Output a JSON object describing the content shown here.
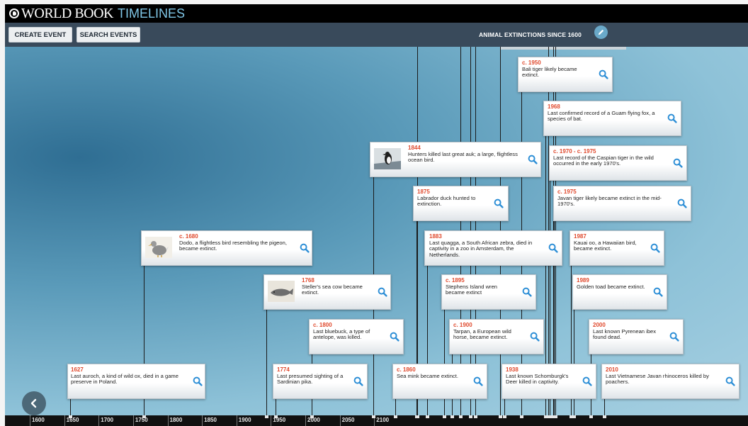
{
  "brand": {
    "name": "WORLD BOOK",
    "product": "TIMELINES"
  },
  "toolbar": {
    "create_label": "CREATE EVENT",
    "search_label": "SEARCH EVENTS",
    "timeline_title": "ANIMAL EXTINCTIONS SINCE 1600"
  },
  "axis": {
    "start": 1600,
    "end": 2100,
    "labels": [
      "1600",
      "1650",
      "1700",
      "1750",
      "1800",
      "1850",
      "1900",
      "1950",
      "2000",
      "2050",
      "2100"
    ]
  },
  "events": [
    {
      "id": "aurochs",
      "year_label": "1627",
      "year": 1627,
      "text": "Last auroch, a kind of wild ox, died in a game preserve in Poland."
    },
    {
      "id": "dodo",
      "year_label": "c. 1680",
      "year": 1680,
      "text": "Dodo, a flightless bird resembling the pigeon, became extinct.",
      "image": "dodo"
    },
    {
      "id": "sea-cow",
      "year_label": "1768",
      "year": 1768,
      "text": "Steller's sea cow became extinct.",
      "image": "sea-cow"
    },
    {
      "id": "pika",
      "year_label": "1774",
      "year": 1774,
      "text": "Last presumed sighting of a Sardinian pika."
    },
    {
      "id": "bluebuck",
      "year_label": "c. 1800",
      "year": 1800,
      "text": "Last bluebuck, a type of antelope, was killed."
    },
    {
      "id": "great-auk",
      "year_label": "1844",
      "year": 1844,
      "text": "Hunters killed last great auk; a large, flightless ocean bird.",
      "image": "great-auk"
    },
    {
      "id": "sea-mink",
      "year_label": "c. 1860",
      "year": 1860,
      "text": "Sea mink became extinct."
    },
    {
      "id": "labrador-duck",
      "year_label": "1875",
      "year": 1875,
      "text": "Labrador duck hunted to extinction."
    },
    {
      "id": "quagga",
      "year_label": "1883",
      "year": 1883,
      "text": "Last quagga, a South African zebra, died in captivity in a zoo in Amsterdam, the Netherlands."
    },
    {
      "id": "wren",
      "year_label": "c. 1895",
      "year": 1895,
      "text": "Stephens Island wren became extinct"
    },
    {
      "id": "tarpan",
      "year_label": "c. 1900",
      "year": 1900,
      "text": "Tarpan, a European wild horse, became extinct."
    },
    {
      "id": "schomburgk",
      "year_label": "1938",
      "year": 1938,
      "text": "Last known Schomburgk's Deer killed in captivity."
    },
    {
      "id": "bali-tiger",
      "year_label": "c. 1950",
      "year": 1950,
      "text": "Bali tiger likely became extinct."
    },
    {
      "id": "flying-fox",
      "year_label": "1968",
      "year": 1968,
      "text": "Last confirmed record of a Guam flying fox, a species of bat."
    },
    {
      "id": "caspian-tiger",
      "year_label": "c. 1970 - c. 1975",
      "year": 1970,
      "text": "Last record of the Caspian tiger in the wild occurred in the early 1970's."
    },
    {
      "id": "javan-tiger",
      "year_label": "c. 1975",
      "year": 1975,
      "text": "Javan tiger likely became extinct in the mid-1970's."
    },
    {
      "id": "kauai-oo",
      "year_label": "1987",
      "year": 1987,
      "text": "Kauai oo, a Hawaiian bird, became extinct."
    },
    {
      "id": "golden-toad",
      "year_label": "1989",
      "year": 1989,
      "text": "Golden toad became extinct."
    },
    {
      "id": "pyrenean-ibex",
      "year_label": "2000",
      "year": 2000,
      "text": "Last known Pyrenean ibex found dead."
    },
    {
      "id": "javan-rhino",
      "year_label": "2010",
      "year": 2010,
      "text": "Last Vietnamese Javan rhinoceros killed by poachers."
    }
  ],
  "icons": {
    "brand": "globe-icon",
    "edit": "pencil-icon",
    "back": "chevron-left-icon",
    "search": "magnifier-icon"
  },
  "colors": {
    "toolbar": "#394a5b",
    "accent_year": "#e04a2e",
    "magnifier": "#2e8fd6",
    "brand_accent": "#7fc6e6"
  }
}
